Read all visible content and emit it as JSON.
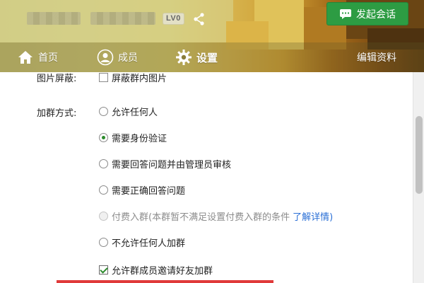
{
  "header": {
    "level_badge": "LV0",
    "start_chat_label": "发起会话",
    "icons": [
      "share-icon",
      "chat-bubble-icon",
      "home-icon",
      "person-icon",
      "gear-icon"
    ]
  },
  "nav": {
    "home": "首页",
    "members": "成员",
    "settings": "设置",
    "edit_profile": "编辑资料"
  },
  "settings": {
    "image_block": {
      "label": "图片屏蔽:",
      "option": "屏蔽群内图片",
      "checked": false
    },
    "join_method": {
      "label": "加群方式:",
      "options": [
        {
          "text": "允许任何人",
          "selected": false
        },
        {
          "text": "需要身份验证",
          "selected": true
        },
        {
          "text": "需要回答问题并由管理员审核",
          "selected": false
        },
        {
          "text": "需要正确回答问题",
          "selected": false
        },
        {
          "text": "付费入群(本群暂不满足设置付费入群的条件",
          "selected": false,
          "disabled": true,
          "link": "了解详情)"
        },
        {
          "text": "不允许任何人加群",
          "selected": false
        }
      ]
    },
    "invite_friends": {
      "text": "允许群成员邀请好友加群",
      "checked": true
    }
  },
  "colors": {
    "accent_green": "#2d9c43",
    "link_blue": "#2a6fd6",
    "highlight_red": "#e03a3a"
  }
}
